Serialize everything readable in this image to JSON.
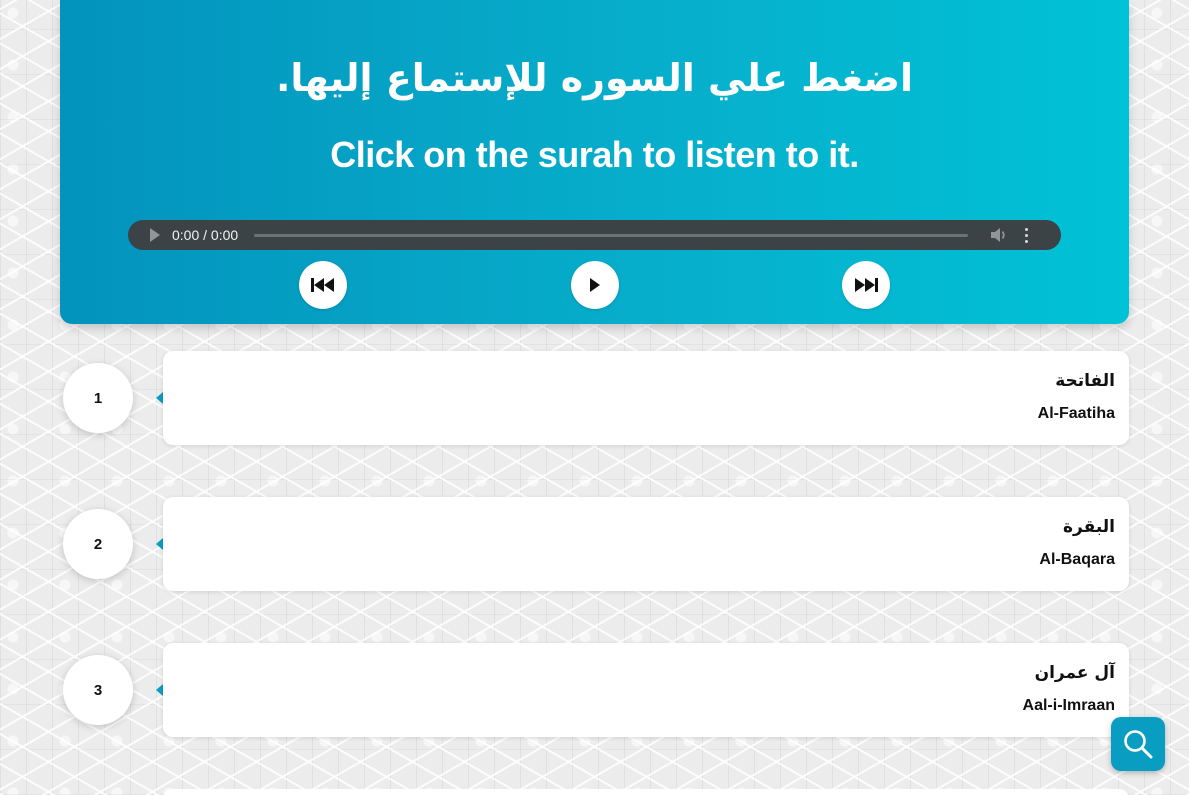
{
  "header": {
    "title_ar": "اضغط علي السوره للإستماع إليها.",
    "title_en": "Click on the surah to listen to it."
  },
  "player": {
    "time": "0:00 / 0:00",
    "progress": 0
  },
  "controls": {
    "previous_icon": "skip-previous-icon",
    "play_icon": "play-icon",
    "next_icon": "skip-next-icon"
  },
  "surahs": [
    {
      "number": "1",
      "name_ar": "الفاتحة",
      "name_en": "Al-Faatiha"
    },
    {
      "number": "2",
      "name_ar": "البقرة",
      "name_en": "Al-Baqara"
    },
    {
      "number": "3",
      "name_ar": "آل عمران",
      "name_en": "Aal-i-Imraan"
    }
  ],
  "search_icon": "search-icon",
  "colors": {
    "accent": "#0a9dc2",
    "header_gradient_start": "#0393bd",
    "header_gradient_end": "#00c2d6",
    "player_bg": "#3b4347"
  }
}
